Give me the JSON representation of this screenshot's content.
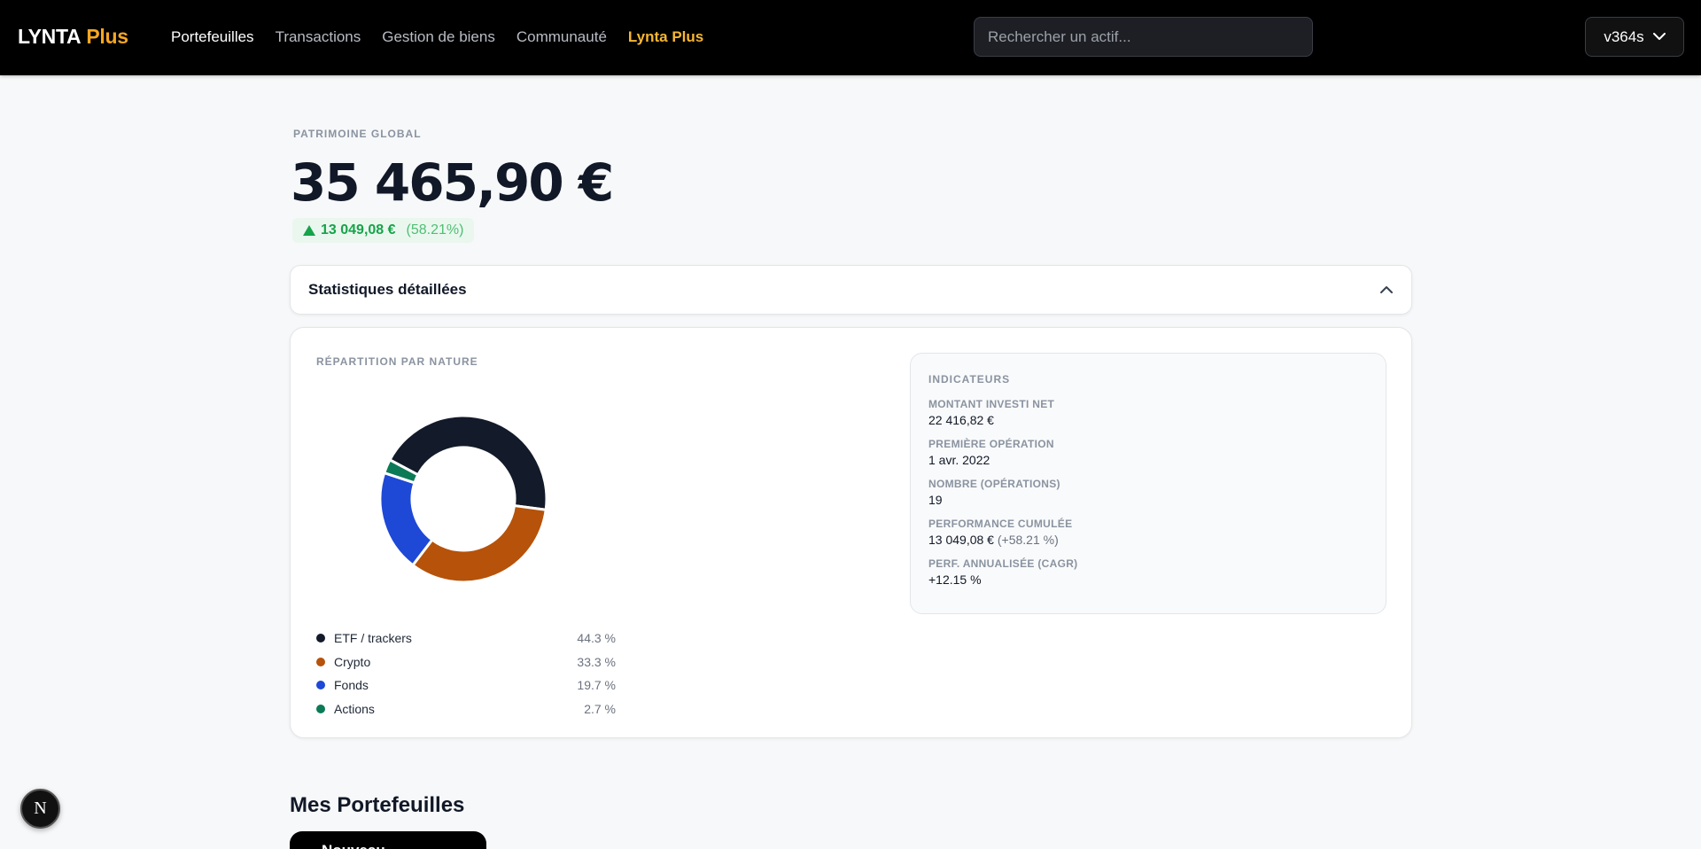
{
  "header": {
    "logo_main": "LYNTA",
    "logo_plus": "Plus",
    "nav": [
      "Portefeuilles",
      "Transactions",
      "Gestion de biens",
      "Communauté",
      "Lynta Plus"
    ],
    "search_placeholder": "Rechercher un actif...",
    "user_label": "v364s"
  },
  "wealth": {
    "label": "PATRIMOINE GLOBAL",
    "value": "35 465,90 €",
    "change": "13 049,08 €",
    "change_pct": "(58.21%)"
  },
  "stats_toggle": {
    "title": "Statistiques détaillées"
  },
  "distribution": {
    "label": "RÉPARTITION PAR NATURE",
    "items": [
      {
        "name": "ETF / trackers",
        "value": "44.3 %",
        "color": "#131a2a"
      },
      {
        "name": "Crypto",
        "value": "33.3 %",
        "color": "#b6520a"
      },
      {
        "name": "Fonds",
        "value": "19.7 %",
        "color": "#1e48d6"
      },
      {
        "name": "Actions",
        "value": "2.7 %",
        "color": "#0c7a57"
      }
    ]
  },
  "chart_data": {
    "type": "pie",
    "categories": [
      "ETF / trackers",
      "Crypto",
      "Fonds",
      "Actions"
    ],
    "values": [
      44.3,
      33.3,
      19.7,
      2.7
    ],
    "colors": [
      "#131a2a",
      "#b6520a",
      "#1e48d6",
      "#0c7a57"
    ],
    "title": "RÉPARTITION PAR NATURE"
  },
  "indicators": {
    "title": "INDICATEURS",
    "items": [
      {
        "key": "MONTANT INVESTI NET",
        "value": "22 416,82 €",
        "sub": ""
      },
      {
        "key": "PREMIÈRE OPÉRATION",
        "value": "1 avr. 2022",
        "sub": ""
      },
      {
        "key": "NOMBRE (OPÉRATIONS)",
        "value": "19",
        "sub": ""
      },
      {
        "key": "PERFORMANCE CUMULÉE",
        "value": "13 049,08 €",
        "sub": "(+58.21 %)"
      },
      {
        "key": "PERF. ANNUALISÉE (CAGR)",
        "value": "+12.15 %",
        "sub": ""
      }
    ]
  },
  "portfolios": {
    "title": "Mes Portefeuilles",
    "new_button": "Nouveau portefeuille"
  },
  "dev_badge": "N"
}
